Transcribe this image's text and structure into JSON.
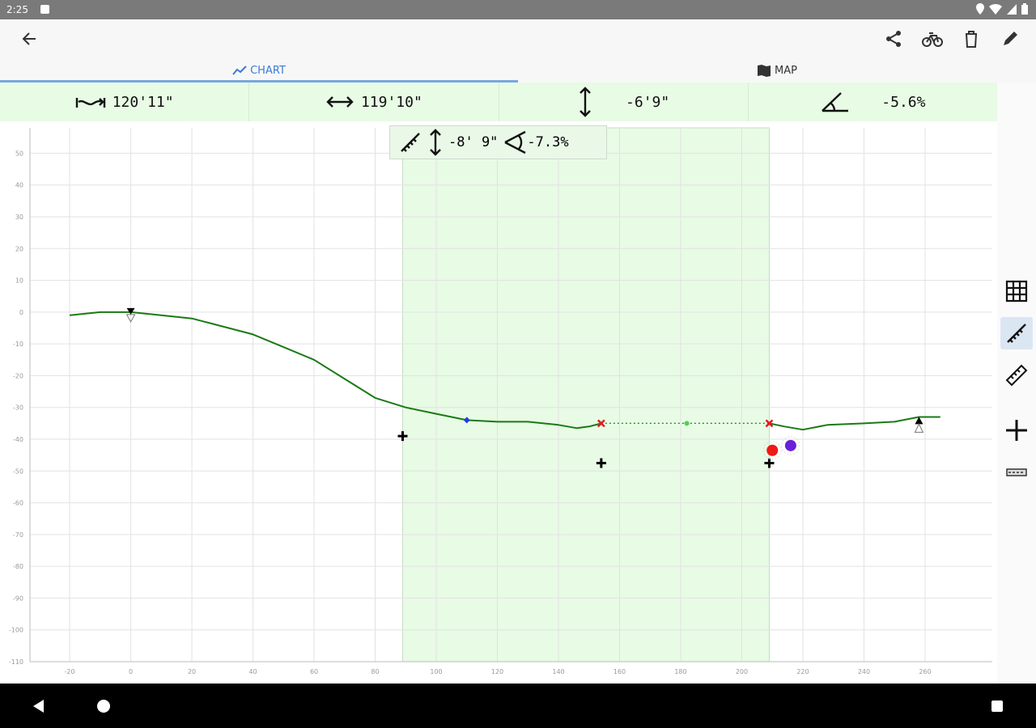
{
  "status": {
    "time": "2:25"
  },
  "tabs": [
    {
      "label": "CHART"
    },
    {
      "label": "MAP"
    }
  ],
  "stats": {
    "distance3d": "120'11\"",
    "distance2d": "119'10\"",
    "elevation_change": "-6'9\"",
    "grade": "-5.6%"
  },
  "selection": {
    "elevation_change": "-8' 9\"",
    "grade": "-7.3%"
  },
  "chart_data": {
    "type": "line",
    "x_ticks": [
      -20,
      0,
      20,
      40,
      60,
      80,
      100,
      120,
      140,
      160,
      180,
      200,
      220,
      240,
      260
    ],
    "y_ticks": [
      50,
      40,
      30,
      20,
      10,
      0,
      -10,
      -20,
      -30,
      -40,
      -50,
      -60,
      -70,
      -80,
      -90,
      -100,
      -110
    ],
    "xlim": [
      -33,
      282
    ],
    "ylim": [
      -110,
      58
    ],
    "selection_range": [
      89,
      209
    ],
    "series": [
      {
        "color": "#1a7a14",
        "x": [
          -20,
          -10,
          0,
          10,
          20,
          30,
          40,
          50,
          60,
          70,
          80,
          90,
          100,
          110,
          120,
          130,
          140,
          146,
          150,
          154
        ],
        "y": [
          -1,
          0,
          0,
          -1,
          -2,
          -4.5,
          -7,
          -11,
          -15,
          -21,
          -27,
          -30,
          -32,
          -34,
          -34.5,
          -34.5,
          -35.5,
          -36.5,
          -36,
          -35
        ]
      },
      {
        "color": "#1a7a14",
        "x": [
          209,
          214,
          220,
          228,
          240,
          250,
          258,
          265
        ],
        "y": [
          -35,
          -36,
          -37,
          -35.5,
          -35,
          -34.5,
          -33,
          -33
        ]
      }
    ],
    "dashed_segment": {
      "x": [
        154,
        209
      ],
      "y": [
        -35,
        -35
      ],
      "color": "#2a8a2a"
    },
    "markers": [
      {
        "type": "diamond",
        "x": 110,
        "y": -34,
        "color": "#1f3fe0"
      },
      {
        "type": "x",
        "x": 154,
        "y": -35,
        "color": "#e01c1c"
      },
      {
        "type": "x",
        "x": 209,
        "y": -35,
        "color": "#e01c1c"
      },
      {
        "type": "dot",
        "x": 182,
        "y": -35,
        "color": "#55cc55"
      },
      {
        "type": "plus",
        "x": 89,
        "y": -39,
        "color": "#000000"
      },
      {
        "type": "plus",
        "x": 154,
        "y": -47.5,
        "color": "#000000"
      },
      {
        "type": "plus",
        "x": 209,
        "y": -47.5,
        "color": "#000000"
      },
      {
        "type": "triangle-down",
        "x": 0,
        "y": 0,
        "color": "#000000"
      },
      {
        "type": "triangle-up",
        "x": 258,
        "y": -34,
        "color": "#000000"
      },
      {
        "type": "big-dot",
        "x": 210,
        "y": -43.5,
        "color": "#f01818"
      },
      {
        "type": "big-dot",
        "x": 216,
        "y": -42,
        "color": "#6a1fd8"
      }
    ]
  }
}
